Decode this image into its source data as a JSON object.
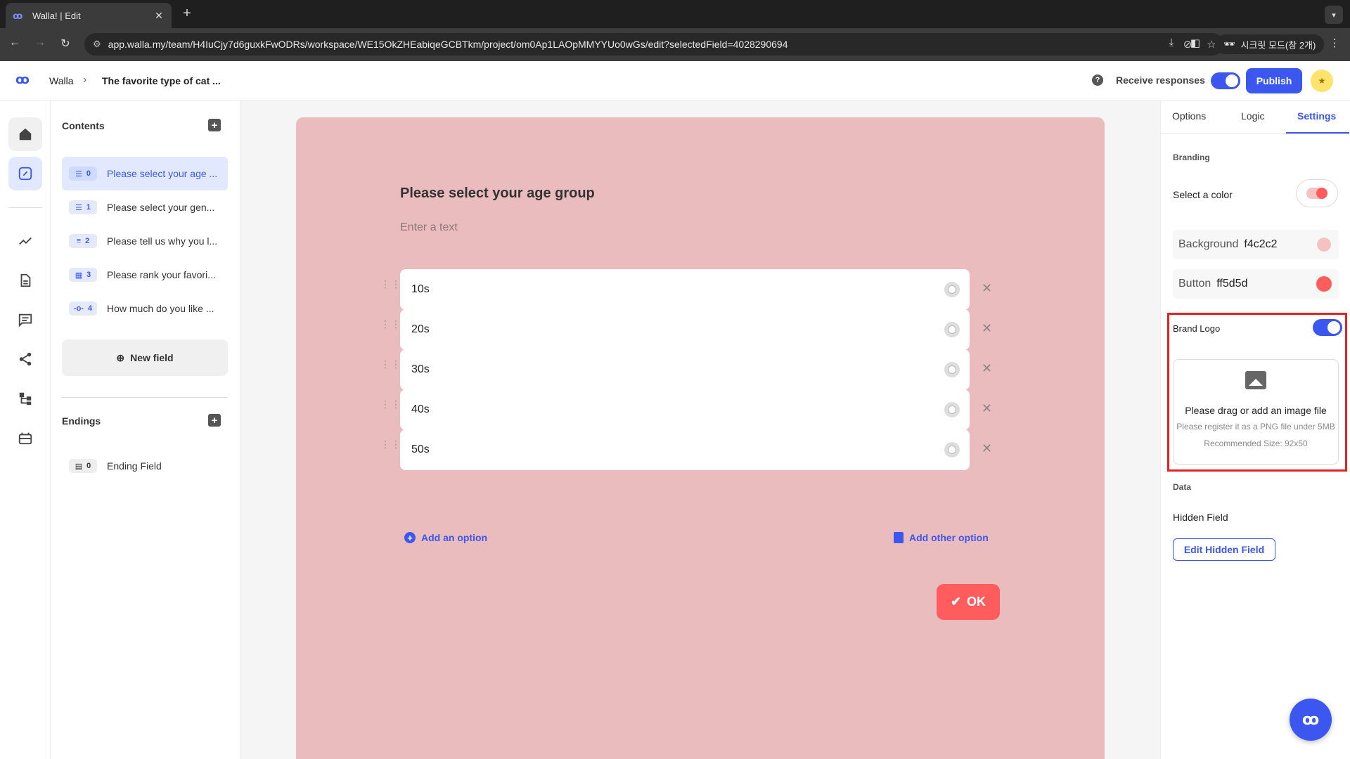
{
  "browser": {
    "tab_title": "Walla! | Edit",
    "url": "app.walla.my/team/H4IuCjy7d6guxkFwODRs/workspace/WE15OkZHEabiqeGCBTkm/project/om0Ap1LAOpMMYYUo0wGs/edit?selectedField=4028290694",
    "incognito_label": "시크릿 모드(창 2개)"
  },
  "header": {
    "breadcrumb_root": "Walla",
    "breadcrumb_sep": "›",
    "breadcrumb_current": "The favorite type of cat ...",
    "receive_label": "Receive responses",
    "receive_on": true,
    "publish_label": "Publish"
  },
  "contents": {
    "title": "Contents",
    "items": [
      {
        "num": "0",
        "label": "Please select your age ..."
      },
      {
        "num": "1",
        "label": "Please select your gen..."
      },
      {
        "num": "2",
        "label": "Please tell us why you l..."
      },
      {
        "num": "3",
        "label": "Please rank your favori..."
      },
      {
        "num": "4",
        "label": "How much do you like ..."
      }
    ],
    "selected_index": 0,
    "new_field_label": "New field",
    "endings_title": "Endings",
    "endings": [
      {
        "num": "0",
        "label": "Ending Field"
      }
    ]
  },
  "question": {
    "title": "Please select your age group",
    "description_placeholder": "Enter a text",
    "options": [
      "10s",
      "20s",
      "30s",
      "40s",
      "50s"
    ],
    "add_option_label": "Add an option",
    "add_other_label": "Add other option",
    "ok_label": "OK",
    "card_color": "#ebbcbd"
  },
  "settings": {
    "tabs": [
      "Options",
      "Logic",
      "Settings"
    ],
    "active_tab": "Settings",
    "branding_title": "Branding",
    "select_color_label": "Select a color",
    "background_label": "Background",
    "background_value": "f4c2c2",
    "button_label": "Button",
    "button_value": "ff5d5d",
    "brand_logo_label": "Brand Logo",
    "brand_logo_on": true,
    "upload_title": "Please drag or add an image file",
    "upload_hint": "Please register it as a PNG file under 5MB",
    "upload_size": "Recommended Size: 92x50",
    "data_title": "Data",
    "hidden_field_label": "Hidden Field",
    "edit_hidden_label": "Edit Hidden Field"
  },
  "colors": {
    "accent": "#3b57f0",
    "background_swatch": "#f4c2c2",
    "button_swatch": "#ff5d5d",
    "highlight_box": "#e32222"
  }
}
